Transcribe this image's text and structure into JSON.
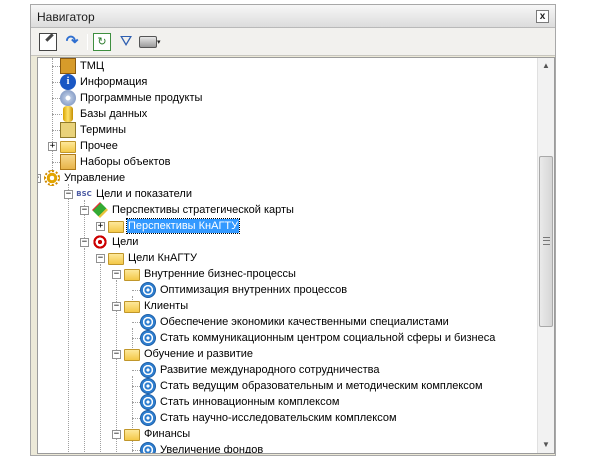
{
  "window": {
    "title": "Навигатор",
    "close_label": "x"
  },
  "toolbar": {
    "dropdown_glyph": "▾",
    "refresh_glyph": "↻",
    "redo_glyph": "↷",
    "filter_glyph": "⛛"
  },
  "scrollbar": {
    "up_glyph": "▲",
    "down_glyph": "▼"
  },
  "tree": {
    "tmc": "ТМЦ",
    "info": "Информация",
    "software": "Программные продукты",
    "databases": "Базы данных",
    "terms": "Термины",
    "other": "Прочее",
    "object_sets": "Наборы объектов",
    "management": "Управление",
    "goals_indicators": "Цели и показатели",
    "strategic_perspectives": "Перспективы стратегической карты",
    "perspectives_knagtu": "Перспективы КнАГТУ",
    "goals": "Цели",
    "goals_knagtu": "Цели КнАГТУ",
    "internal_processes": "Внутренние бизнес-процессы",
    "optimize_processes": "Оптимизация внутренних процессов",
    "clients": "Клиенты",
    "provide_specialists": "Обеспечение экономики качественными специалистами",
    "comm_center": "Стать коммуникационным центром социальной сферы и бизнеса",
    "learning": "Обучение и развитие",
    "intl_cooperation": "Развитие международного сотрудничества",
    "leading_complex": "Стать ведущим образовательным и методическим комплексом",
    "innovation_complex": "Стать инновационным комплексом",
    "research_complex": "Стать научно-исследовательским комплексом",
    "finance": "Финансы",
    "increase_funds": "Увеличение фондов",
    "expand_plus": "+",
    "expand_minus": "−",
    "bsc_glyph": "BSC",
    "info_glyph": "i"
  }
}
